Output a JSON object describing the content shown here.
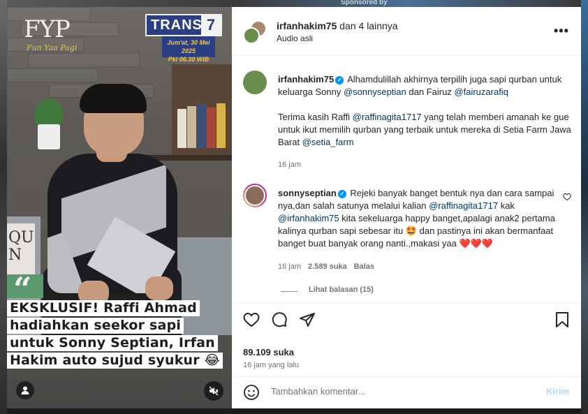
{
  "backdrop": {
    "sponsored": "Sponsored by"
  },
  "video": {
    "show_logo": "FYP",
    "show_logo_sub": "Fun Yaa Pagi",
    "channel_name": "TRANS",
    "channel_number": "7",
    "air_date_line1": "Jum'at, 30 Mei 2025",
    "air_date_line2": "Pkl 06.30 WIB",
    "sign_text": "QU N",
    "caption_lines": [
      "EKSKLUSIF! Raffi Ahmad",
      "hadiahkan seekor sapi",
      "untuk Sonny Septian, Irfan",
      "Hakim auto sujud syukur 😂"
    ]
  },
  "header": {
    "username": "irfanhakim75",
    "and_others": "dan 4 lainnya",
    "audio": "Audio asli",
    "more": "•••"
  },
  "caption": {
    "username": "irfanhakim75",
    "para1_text1": "Alhamdulillah akhirnya terpilih juga sapi qurban untuk keluarga Sonny ",
    "para1_mention1": "@sonnyseptian",
    "para1_text2": " dan Fairuz ",
    "para1_mention2": "@fairuzarafiq",
    "para2_text1": "Terima kasih Raffi ",
    "para2_mention1": "@raffinagita1717",
    "para2_text2": " yang telah memberi amanah ke gue untuk ikut memilih qurban yang terbaik untuk mereka di Setia Farm Jawa Barat ",
    "para2_mention2": "@setia_farm",
    "time": "16 jam"
  },
  "comment": {
    "username": "sonnyseptian",
    "text1": "Rejeki banyak banget bentuk nya dan cara sampai nya,dan salah satunya melalui kalian ",
    "mention1": "@raffinagita1717",
    "text2": " kak ",
    "mention2": "@irfanhakim75",
    "text3": " kita sekeluarga happy banget,apalagi anak2 pertama kalinya qurban sapi sebesar itu 🤩 dan pastinya ini akan bermanfaat banget buat banyak orang nanti.,makasi yaa ❤️❤️❤️",
    "time": "16 jam",
    "likes": "2.589 suka",
    "reply": "Balas",
    "view_replies": "Lihat balasan (15)"
  },
  "actions": {
    "likes": "89.109 suka",
    "time_ago": "16 jam yang lalu"
  },
  "add_comment": {
    "placeholder": "Tambahkan komentar...",
    "post": "Kirim"
  },
  "colors": {
    "mention": "#00376b",
    "verified": "#0095f6",
    "post_disabled": "#b3dbff"
  }
}
